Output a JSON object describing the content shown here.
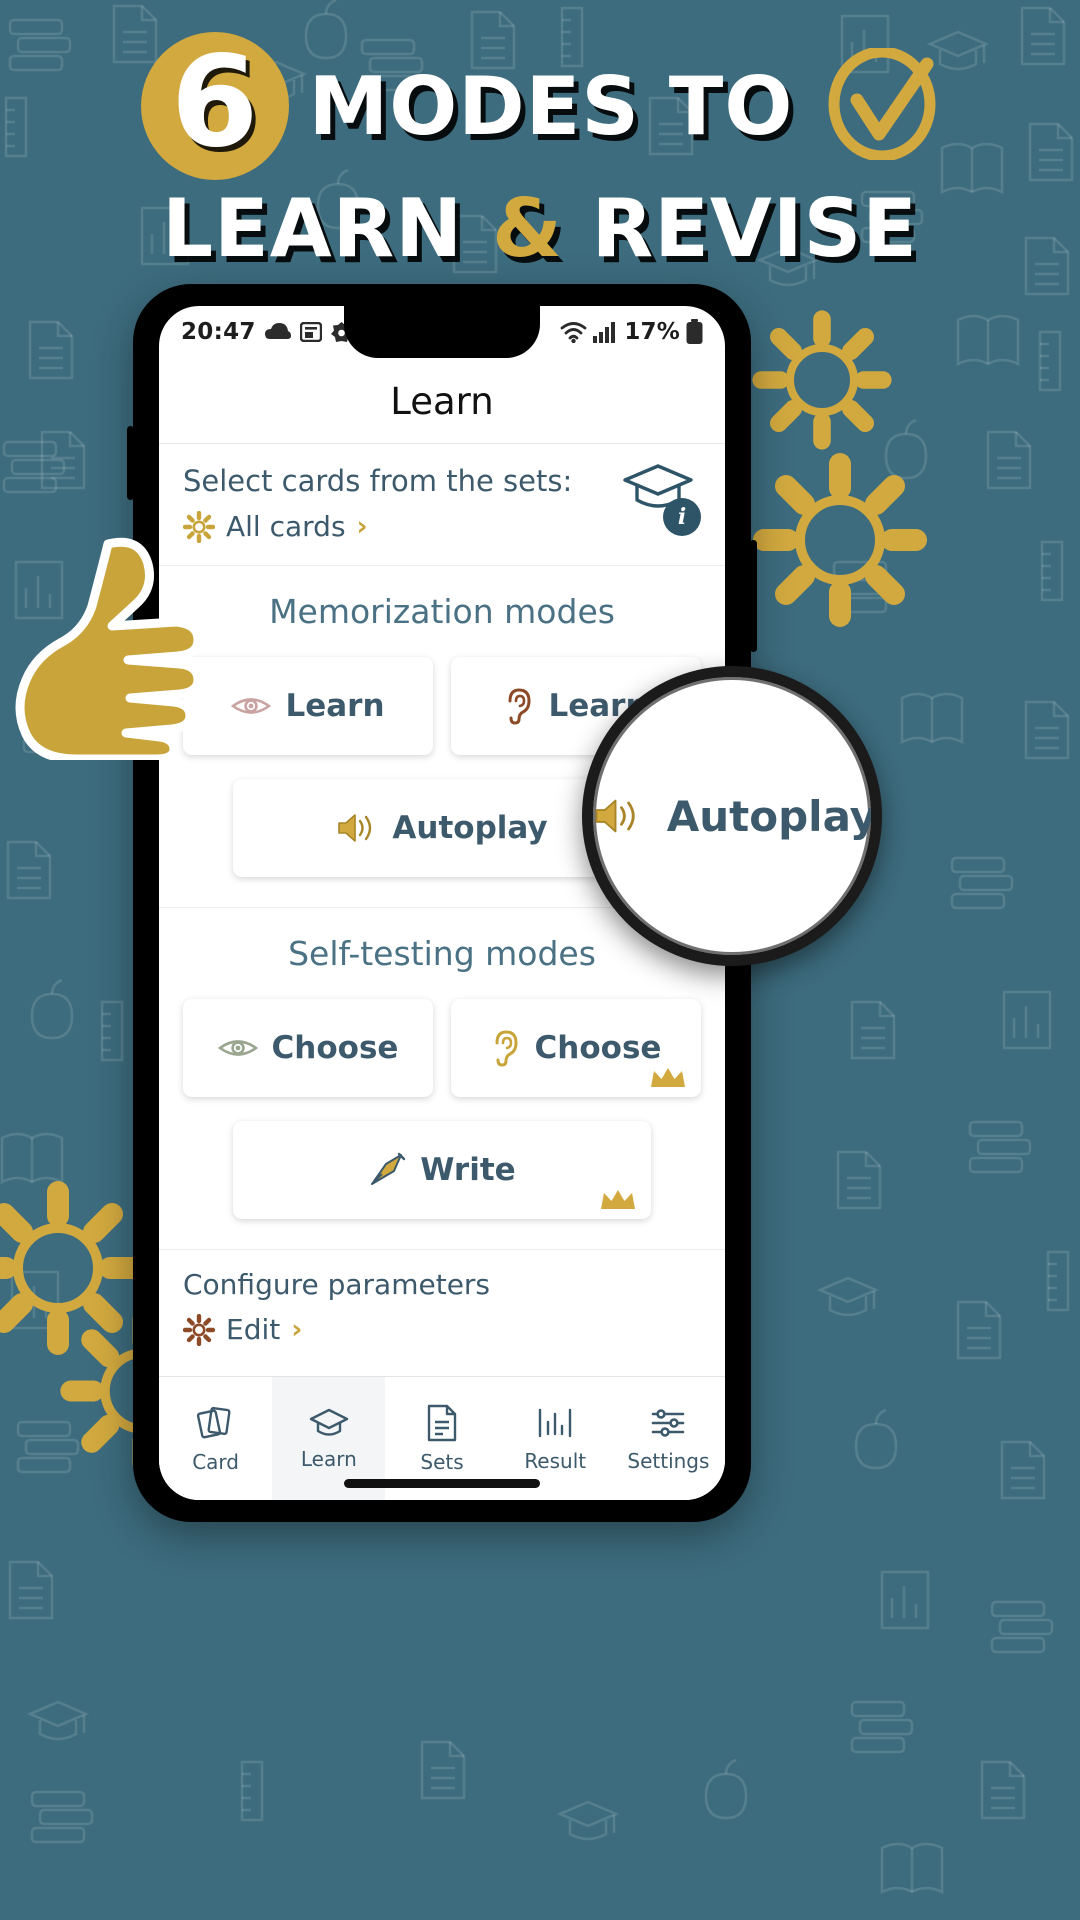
{
  "banner": {
    "badge_number": "6",
    "headline_line1": "MODES TO",
    "headline_line2_a": "LEARN ",
    "headline_line2_amp": "&",
    "headline_line2_b": " REVISE",
    "check_icon": "check-circle-icon",
    "colors": {
      "background": "#3d6c7e",
      "accent_gold": "#d2a93f",
      "text_white": "#ffffff",
      "app_blue": "#3d5a6c"
    }
  },
  "phone": {
    "statusbar": {
      "time": "20:47",
      "icons_left": [
        "cloud-icon",
        "screenshot-icon",
        "puzzle-icon",
        "dot-icon"
      ],
      "wifi_icon": "wifi-icon",
      "signal_icon": "signal-bars-icon",
      "battery_percent": "17%",
      "battery_icon": "battery-icon"
    },
    "app": {
      "title": "Learn",
      "select_cards": {
        "label": "Select cards from the sets:",
        "gear_icon": "gear-icon",
        "value": "All cards",
        "chevron": "›",
        "hat_icon": "graduation-cap-icon",
        "info_badge": "i"
      },
      "memorization": {
        "title": "Memorization modes",
        "modes": [
          {
            "icon": "eye-icon",
            "label": "Learn",
            "crown": false
          },
          {
            "icon": "ear-icon",
            "label": "Learn",
            "crown": false
          },
          {
            "icon": "speaker-icon",
            "label": "Autoplay",
            "crown": false
          }
        ]
      },
      "selftesting": {
        "title": "Self-testing modes",
        "modes": [
          {
            "icon": "eye-icon",
            "label": "Choose",
            "crown": false
          },
          {
            "icon": "ear-icon",
            "label": "Choose",
            "crown": true
          },
          {
            "icon": "pen-nib-icon",
            "label": "Write",
            "crown": true
          }
        ]
      },
      "configure": {
        "label": "Configure parameters",
        "gear_icon": "gear-icon",
        "value": "Edit",
        "chevron": "›"
      },
      "bottom_nav": [
        {
          "icon": "cards-icon",
          "label": "Card",
          "active": false
        },
        {
          "icon": "graduation-cap-icon",
          "label": "Learn",
          "active": true
        },
        {
          "icon": "document-icon",
          "label": "Sets",
          "active": false
        },
        {
          "icon": "chart-icon",
          "label": "Result",
          "active": false
        },
        {
          "icon": "sliders-icon",
          "label": "Settings",
          "active": false
        }
      ]
    }
  },
  "overlay": {
    "hand_cursor_icon": "hand-pointer-icon",
    "magnifier": {
      "icon": "speaker-icon",
      "label": "Autoplay"
    },
    "gears": [
      "gear-icon",
      "gear-icon",
      "gear-icon",
      "gear-icon"
    ]
  }
}
